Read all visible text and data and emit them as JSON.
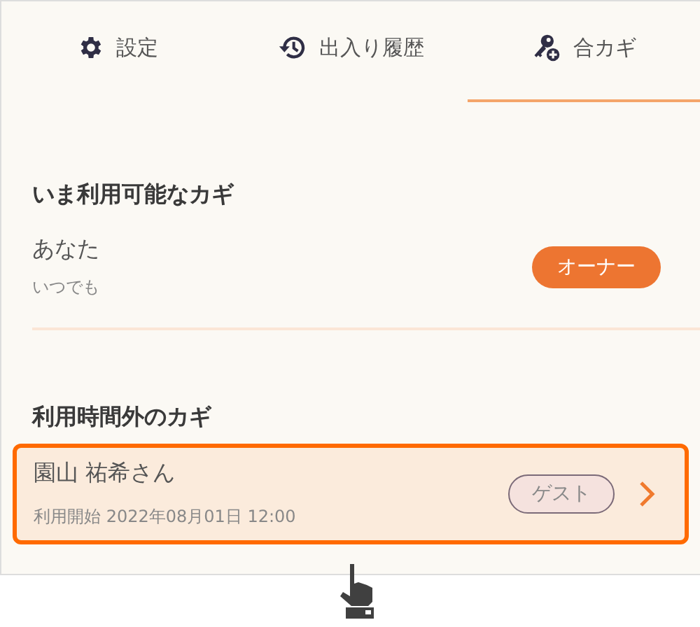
{
  "tabs": [
    {
      "label": "設定",
      "kind": "gear",
      "selected": false
    },
    {
      "label": "出入り履歴",
      "kind": "history",
      "selected": false
    },
    {
      "label": "合カギ",
      "kind": "key-add",
      "selected": true
    }
  ],
  "sections": [
    {
      "title": "いま利用可能なカギ",
      "keys": [
        {
          "name": "あなた",
          "detail": "いつでも",
          "badge": "オーナー",
          "kind": "owner",
          "chevron": false,
          "selected": false
        }
      ]
    },
    {
      "title": "利用時間外のカギ",
      "keys": [
        {
          "name": "園山 祐希さん",
          "detail": "利用開始 2022年08月01日 12:00",
          "badge": "ゲスト",
          "kind": "guest",
          "chevron": true,
          "selected": true
        }
      ]
    }
  ]
}
